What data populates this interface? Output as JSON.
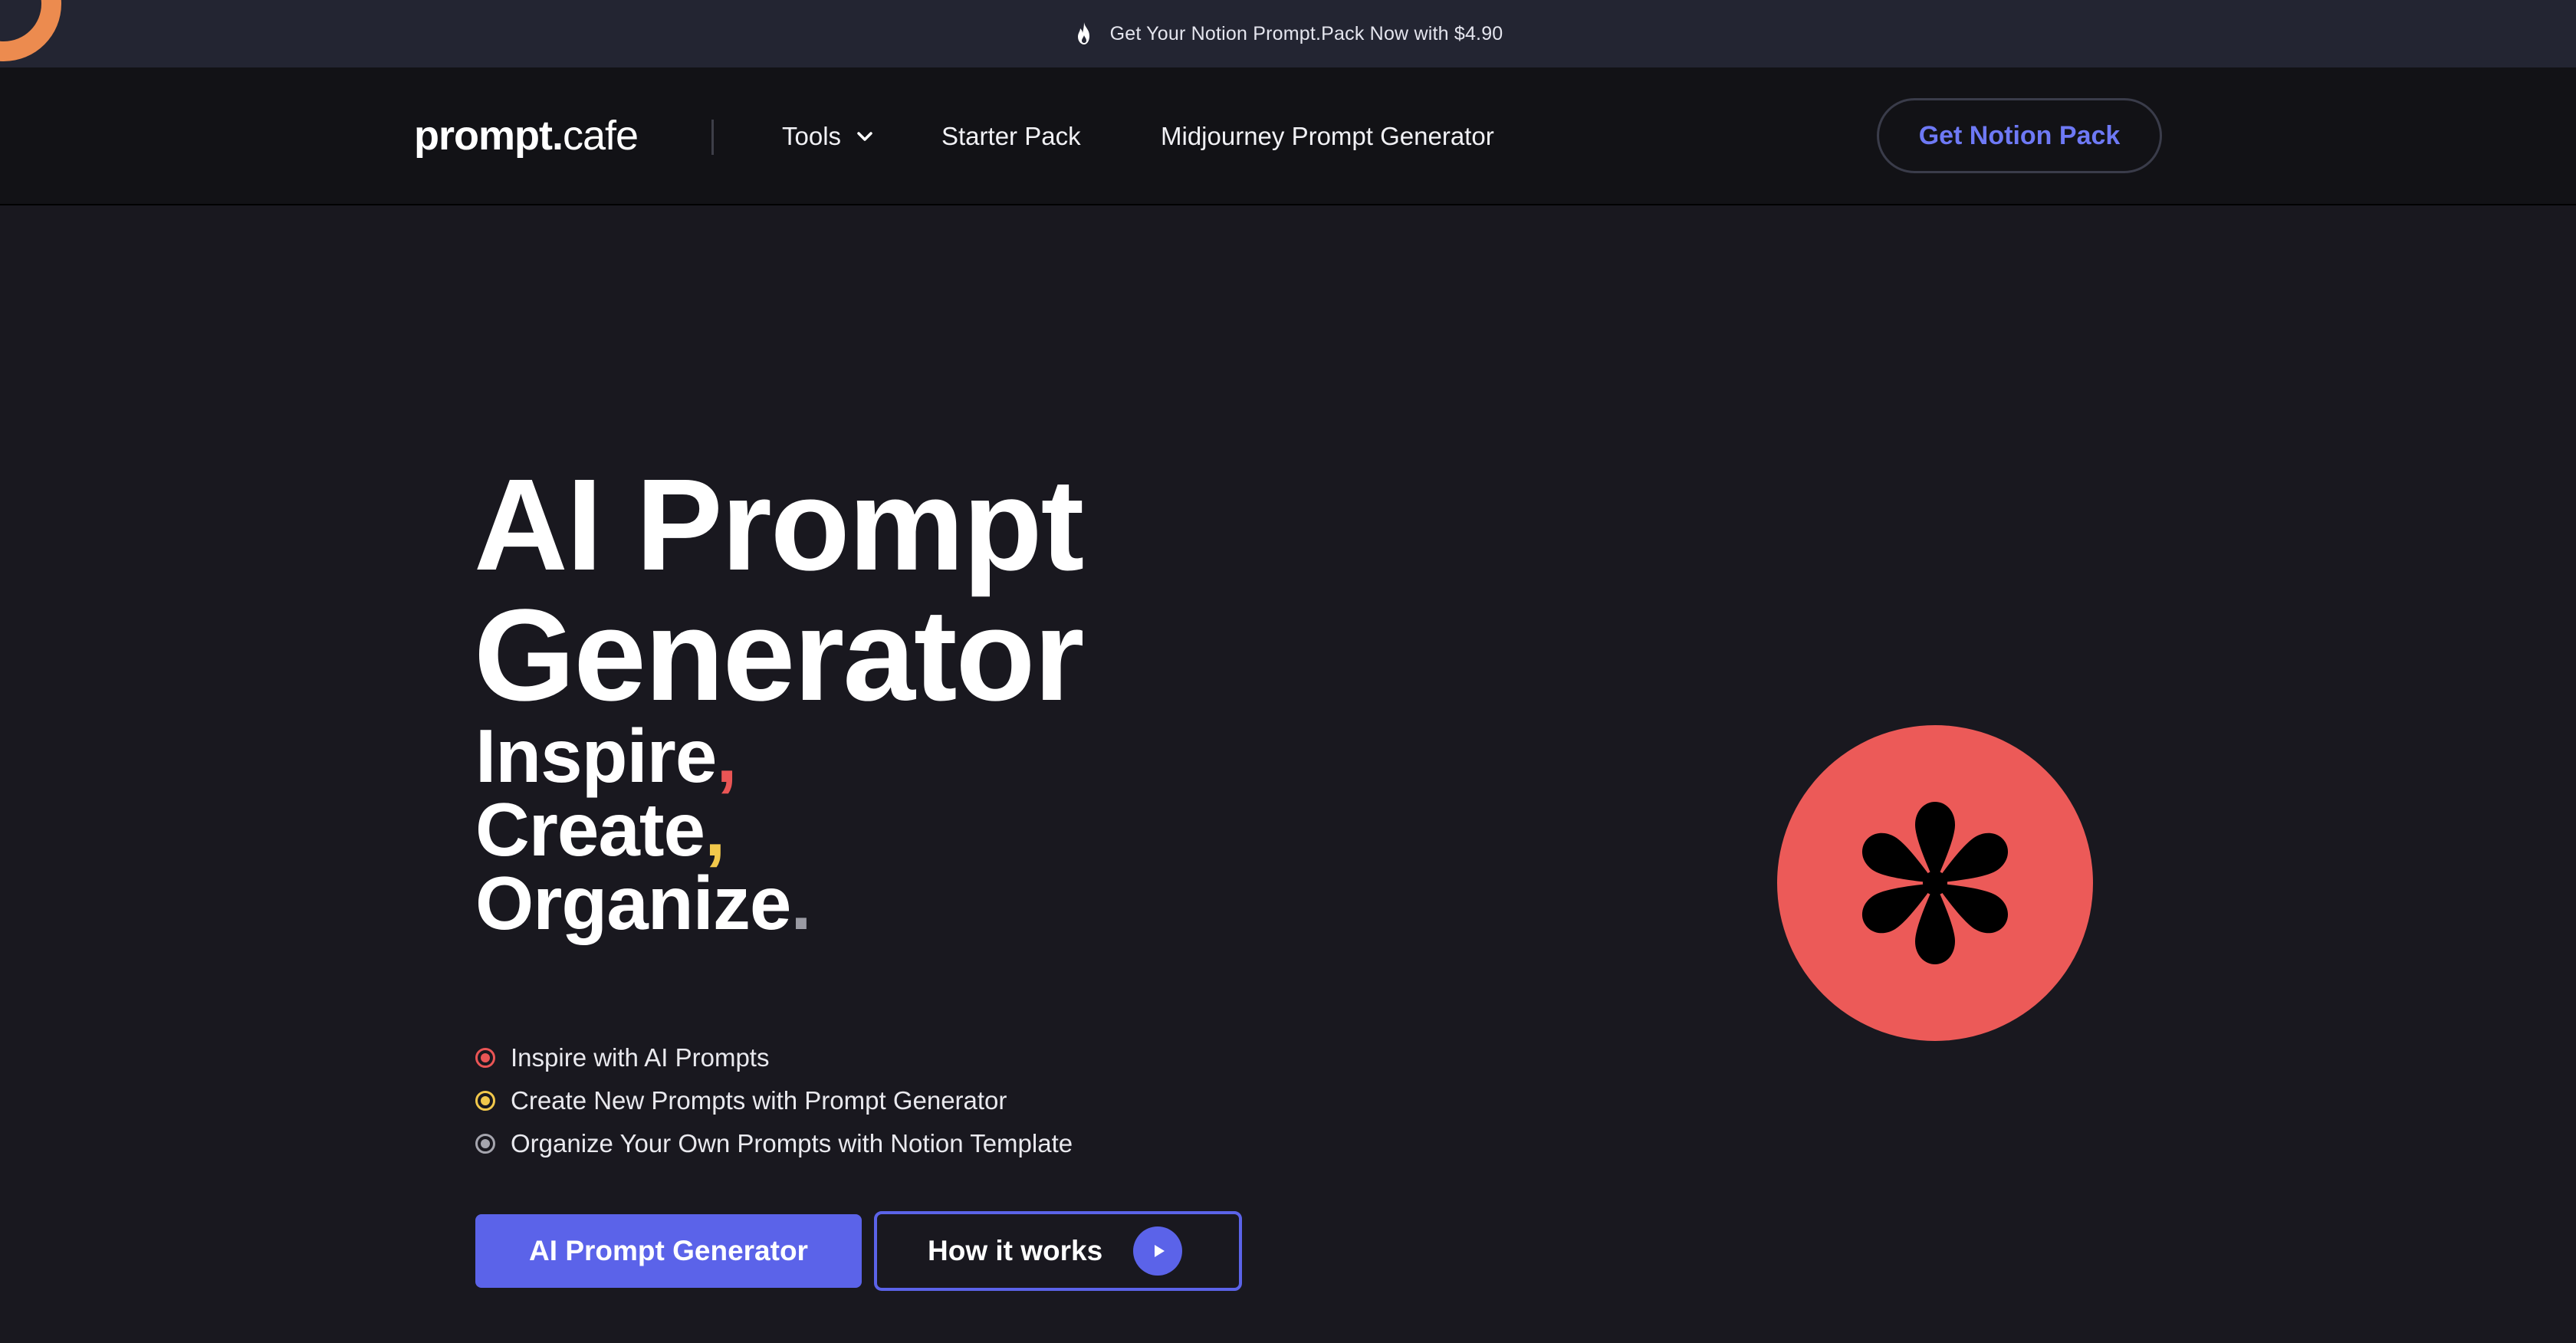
{
  "announcement": {
    "icon": "fire-icon",
    "text": "Get Your Notion Prompt.Pack Now with $4.90"
  },
  "nav": {
    "logo": {
      "main": "prompt",
      "dot": ".",
      "suffix": "cafe"
    },
    "items": [
      {
        "label": "Tools",
        "icon": "chevron-down-icon"
      },
      {
        "label": "Starter Pack"
      },
      {
        "label": "Midjourney Prompt Generator"
      }
    ],
    "cta": "Get Notion Pack"
  },
  "hero": {
    "title_line1": "AI Prompt",
    "title_line2": "Generator",
    "words": [
      {
        "word": "Inspire",
        "punct": ","
      },
      {
        "word": "Create",
        "punct": ","
      },
      {
        "word": "Organize",
        "punct": "."
      }
    ],
    "features": [
      "Inspire with AI Prompts",
      "Create New Prompts with Prompt Generator",
      "Organize Your Own Prompts with Notion Template"
    ],
    "primary_button": "AI Prompt Generator",
    "secondary_button": "How it works",
    "secondary_icon": "play-icon"
  },
  "colors": {
    "accent": "#5b63e9",
    "red": "#ea5555",
    "yellow": "#f2c84b",
    "gray": "#9a9aa3",
    "background": "#19181f"
  }
}
